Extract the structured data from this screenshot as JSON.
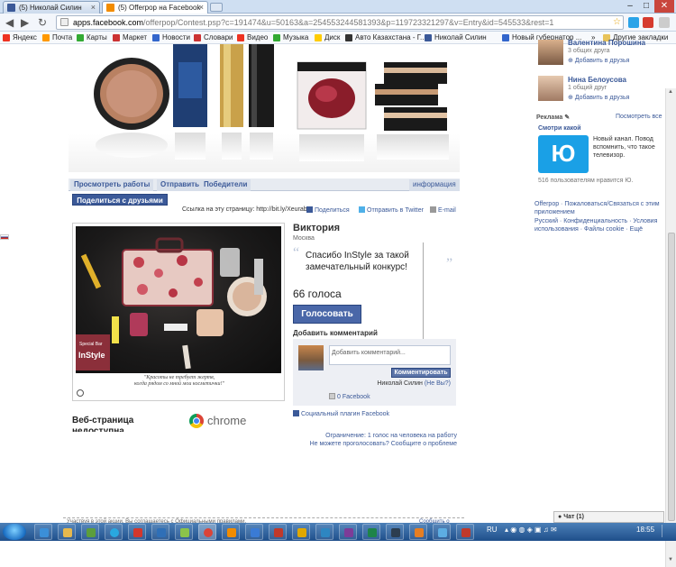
{
  "browser": {
    "tabs": [
      {
        "label": "(5) Николай Силин",
        "active": false
      },
      {
        "label": "(5) Offerpop на Facebook",
        "active": true
      }
    ],
    "url_host": "apps.facebook.com",
    "url_path": "/offerpop/Contest.psp?c=191474&u=50163&a=254553244581393&p=119723321297&v=Entry&id=545533&rest=1",
    "bookmarks": [
      "Яндекс",
      "Почта",
      "Карты",
      "Маркет",
      "Новости",
      "Словари",
      "Видео",
      "Музыка",
      "Диск",
      "Авто Казахстана - Г...",
      "Николай Силин",
      "Новый губернатор ..."
    ],
    "bookmarks_more": "»",
    "other_bookmarks": "Другие закладки",
    "window_controls": {
      "minimize": "–",
      "maximize": "□",
      "close": "✕"
    },
    "accent": "#3b5998"
  },
  "contest": {
    "nav_tabs": [
      "Просмотреть работы",
      "Отправить",
      "Победители"
    ],
    "info_tab": "информация",
    "share_button": "Поделиться с друзьями",
    "link_label": "Ссылка на эту страницу: http://bit.ly/Xeurab",
    "share_link": "Поделиться",
    "twitter_link": "Отправить в Twitter",
    "email_link": "E-mail",
    "photo_caption_1": "\"Красоты не требует жертв,",
    "photo_caption_2": "когда рядом со мной мои косметички!\"",
    "photo_label": "InStyle",
    "photo_label_small": "Special Bar",
    "entrant_name": "Виктория",
    "entrant_city": "Москва",
    "quote": "Спасибо InStyle за такой замечательный конкурс!",
    "votes": "66 голоса",
    "vote_button": "Голосовать",
    "add_comment": "Добавить комментарий",
    "comment_placeholder": "Добавить комментарий...",
    "comment_button": "Комментировать",
    "comment_user": "Николай Силин",
    "comment_user_link": "(Не Вы?)",
    "fb_comment": "0 Facebook",
    "social_plugin": "Социальный плагин Facebook",
    "limit_1": "Ограничение: 1 голос на человека на работу",
    "limit_2": "Не можете проголосовать? Сообщите о проблеме",
    "webpage_title_1": "Веб-страница",
    "webpage_title_2": "недоступна",
    "chrome_text": "chrome",
    "footer_rules": "Участвуя в этой акции, Вы соглашаетесь с Официальными правилами.",
    "footer_report": "Сообщить о"
  },
  "sidebar": {
    "people": [
      {
        "name": "Валентина Порошина",
        "sub": "3 общих друга",
        "add": "Добавить в друзья"
      },
      {
        "name": "Нина Белоусова",
        "sub": "1 общий друг",
        "add": "Добавить в друзья"
      }
    ],
    "ads_head": "Реклама",
    "ads_more": "Посмотреть все",
    "ad_title": "Смотри какой",
    "ad_text": "Новый канал. Повод вспомнить, что такое телевизор.",
    "ad_logo": "Ю",
    "ad_likes": "516 пользователям нравится Ю.",
    "offerpop_line": "Offerpop · Пожаловаться/Связаться с этим приложением",
    "lang_line": "Русский · Конфиденциальность · Условия использования · Файлы cookie · Ещё",
    "chat": "Чат (1)"
  },
  "taskbar": {
    "lang": "RU",
    "time": "18:55"
  }
}
